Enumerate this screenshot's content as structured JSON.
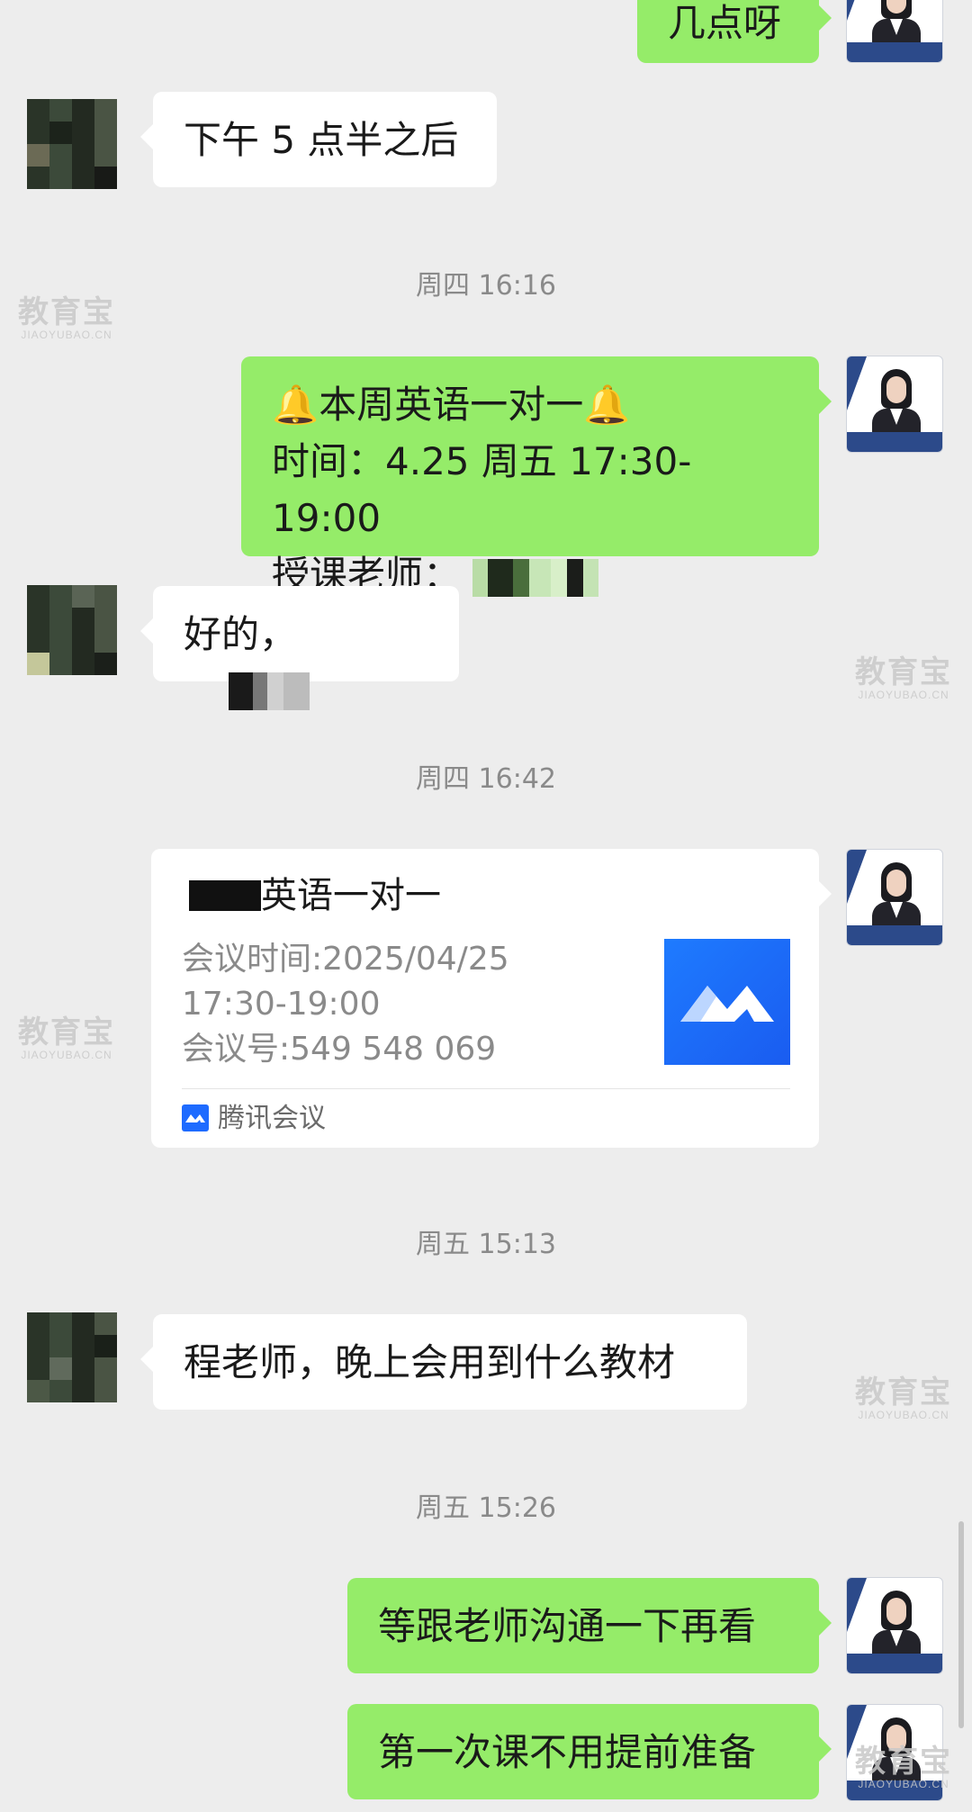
{
  "colors": {
    "background": "#ededed",
    "left_bubble": "#ffffff",
    "right_bubble": "#95ec69",
    "timestamp": "#8a8a8a",
    "meeting_blue": "#1e6bff"
  },
  "messages": {
    "m0": {
      "text": "几点呀"
    },
    "m1": {
      "text": "下午 5 点半之后"
    },
    "m2": {
      "line1": "🔔本周英语一对一🔔",
      "line2": "时间：4.25 周五 17:30-19:00",
      "line3_label": "授课老师："
    },
    "m3": {
      "text": "好的，"
    },
    "m5": {
      "text": "程老师，晚上会用到什么教材"
    },
    "m6": {
      "text": "等跟老师沟通一下再看"
    },
    "m7": {
      "text": "第一次课不用提前准备"
    }
  },
  "timestamps": {
    "t1": "周四 16:16",
    "t2": "周四 16:42",
    "t3": "周五 15:13",
    "t4": "周五 15:26"
  },
  "meeting_card": {
    "title": "英语一对一",
    "time_line1": "会议时间:2025/04/25",
    "time_line2": "17:30-19:00",
    "meeting_id": "会议号:549 548 069",
    "app_name": "腾讯会议",
    "logo_icon": "tencent-meeting-icon"
  },
  "watermark": {
    "main": "教育宝",
    "sub": "JIAOYUBAO.CN"
  }
}
